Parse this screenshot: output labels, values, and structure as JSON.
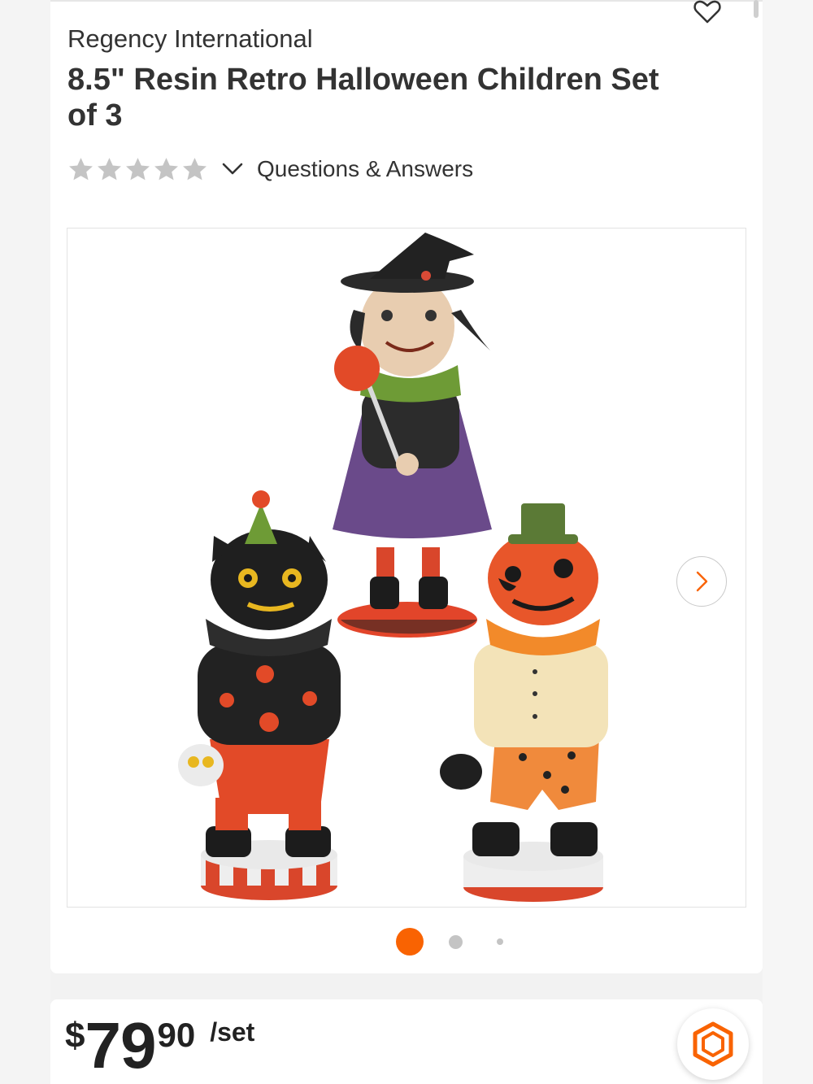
{
  "product": {
    "brand": "Regency International",
    "title": "8.5\" Resin Retro Halloween Children Set of 3",
    "rating_stars": 0,
    "questions_label": "Questions & Answers"
  },
  "gallery": {
    "current_index": 1,
    "total": 3
  },
  "price": {
    "currency": "$",
    "whole": "79",
    "cents": "90",
    "unit": "/set"
  },
  "colors": {
    "accent": "#f96302",
    "star_empty": "#c4c4c4",
    "text": "#333333"
  },
  "icons": [
    "heart-icon",
    "star-icon",
    "chevron-down-icon",
    "chevron-right-icon",
    "hexagon-logo-icon"
  ]
}
